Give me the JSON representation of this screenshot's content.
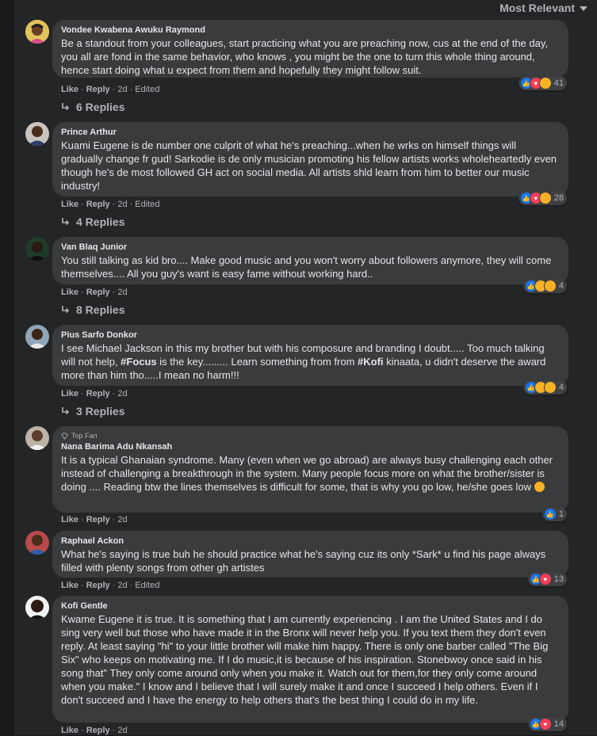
{
  "sort_label": "Most Relevant",
  "action_like": "Like",
  "action_reply": "Reply",
  "colors": {
    "like": "#1877f2",
    "love": "#f33e58",
    "haha": "#f7b125"
  },
  "comments": [
    {
      "author": "Vondee Kwabena Awuku Raymond",
      "text": "Be a standout from your colleagues, start practicing what you are preaching now, cus at the end of the day, you all are fond in the same behavior, who knows , you might be the one to turn this whole thing around, hence start doing what u expect from them and hopefully they might follow suit.",
      "time": "2d",
      "edited": "Edited",
      "reactions": [
        "like-icon",
        "love-icon",
        "haha-icon"
      ],
      "reaction_count": "41",
      "replies": "6 Replies"
    },
    {
      "author": "Prince Arthur",
      "text": "Kuami Eugene is de number one culprit of what he's preaching...when he wrks on himself things will gradually change fr gud! Sarkodie is de only musician promoting his fellow artists works wholeheartedly even though he's de most followed GH act on social media. All artists shld learn from him to better our music industry!",
      "time": "2d",
      "edited": "Edited",
      "reactions": [
        "like-icon",
        "love-icon",
        "haha-icon"
      ],
      "reaction_count": "28",
      "replies": "4 Replies"
    },
    {
      "author": "Van Blaq Junior",
      "text": "You still talking as kid bro.... Make good music and you won't worry about followers anymore, they will come themselves.... All you guy's want is easy fame without working hard..",
      "time": "2d",
      "reactions": [
        "like-icon",
        "wow-icon",
        "haha-icon"
      ],
      "reaction_count": "4",
      "replies": "8 Replies"
    },
    {
      "author": "Pius Sarfo Donkor",
      "text_parts": [
        "I see Michael Jackson in this my brother but with his composure and branding I doubt..... Too much talking will not help, ",
        "#Focus",
        " is the key......... Learn something from from ",
        "#Kofi",
        " kinaata, u didn't deserve the award more than him tho.....I mean no harm!!!"
      ],
      "time": "2d",
      "reactions": [
        "like-icon",
        "haha-icon",
        "haha-icon"
      ],
      "reaction_count": "4",
      "replies": "3 Replies"
    },
    {
      "badge": "Top Fan",
      "author": "Nana Barima Adu Nkansah",
      "text": "It is a typical Ghanaian syndrome. Many (even when we go abroad) are always busy challenging each other instead of challenging a breakthrough in the system. Many people focus more on what the brother/sister is doing .... Reading btw the lines themselves is difficult for some, that is why you go low, he/she goes low",
      "time": "2d",
      "reactions": [
        "like-icon"
      ],
      "reaction_count": "1"
    },
    {
      "author": "Raphael Ackon",
      "text": "What he's saying is true buh he should practice what he's saying cuz its only *Sark* u find his page always filled with plenty songs from other gh artistes",
      "time": "2d",
      "edited": "Edited",
      "reactions": [
        "like-icon",
        "love-icon"
      ],
      "reaction_count": "13"
    },
    {
      "author": "Kofi Gentle",
      "text": "Kwame Eugene it is true. It is something that I am currently experiencing . I am the United States and I do sing very well but those who have made it in the Bronx will never help you. If you text them they don't even reply. At least saying \"hi\" to your little brother will make him happy. There is only one barber called \"The Big Six\" who keeps on motivating me. If I do music,it is because of his inspiration. Stonebwoy once said in his song that\" They only come around only when you make it. Watch out for them,for they only come around when you make.\" I know and I believe that I will surely make it and once I succeed I help others. Even if I don't succeed and I have the energy to help others that's the best thing I could do in my life.",
      "time": "2d",
      "reactions": [
        "like-icon",
        "love-icon"
      ],
      "reaction_count": "14"
    }
  ]
}
